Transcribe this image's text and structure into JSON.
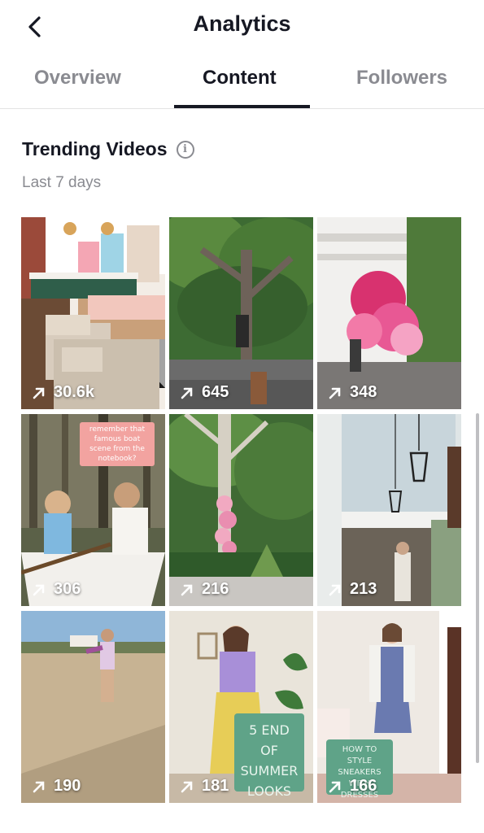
{
  "header": {
    "title": "Analytics"
  },
  "tabs": [
    {
      "label": "Overview",
      "active": false
    },
    {
      "label": "Content",
      "active": true
    },
    {
      "label": "Followers",
      "active": false
    }
  ],
  "section": {
    "title": "Trending Videos",
    "subtitle": "Last 7 days"
  },
  "videos": [
    {
      "views": "30.6k",
      "scene": "interior living room"
    },
    {
      "views": "645",
      "scene": "oak trees driveway"
    },
    {
      "views": "348",
      "scene": "pink balloon arch house"
    },
    {
      "views": "306",
      "scene": "couple in rowboat",
      "overlay_text": "remember that famous boat scene from the notebook?"
    },
    {
      "views": "216",
      "scene": "pink balloon tree"
    },
    {
      "views": "213",
      "scene": "porch with lanterns"
    },
    {
      "views": "190",
      "scene": "beach sand"
    },
    {
      "views": "181",
      "scene": "purple yellow dress",
      "overlay_text": "5 END OF SUMMER LOOKS"
    },
    {
      "views": "166",
      "scene": "white jacket dress",
      "overlay_text": "HOW TO STYLE SNEAKERS WITH DRESSES"
    }
  ],
  "colors": {
    "text_primary": "#161823",
    "text_secondary": "#8a8b91",
    "overlay_green": "#5fa388"
  }
}
